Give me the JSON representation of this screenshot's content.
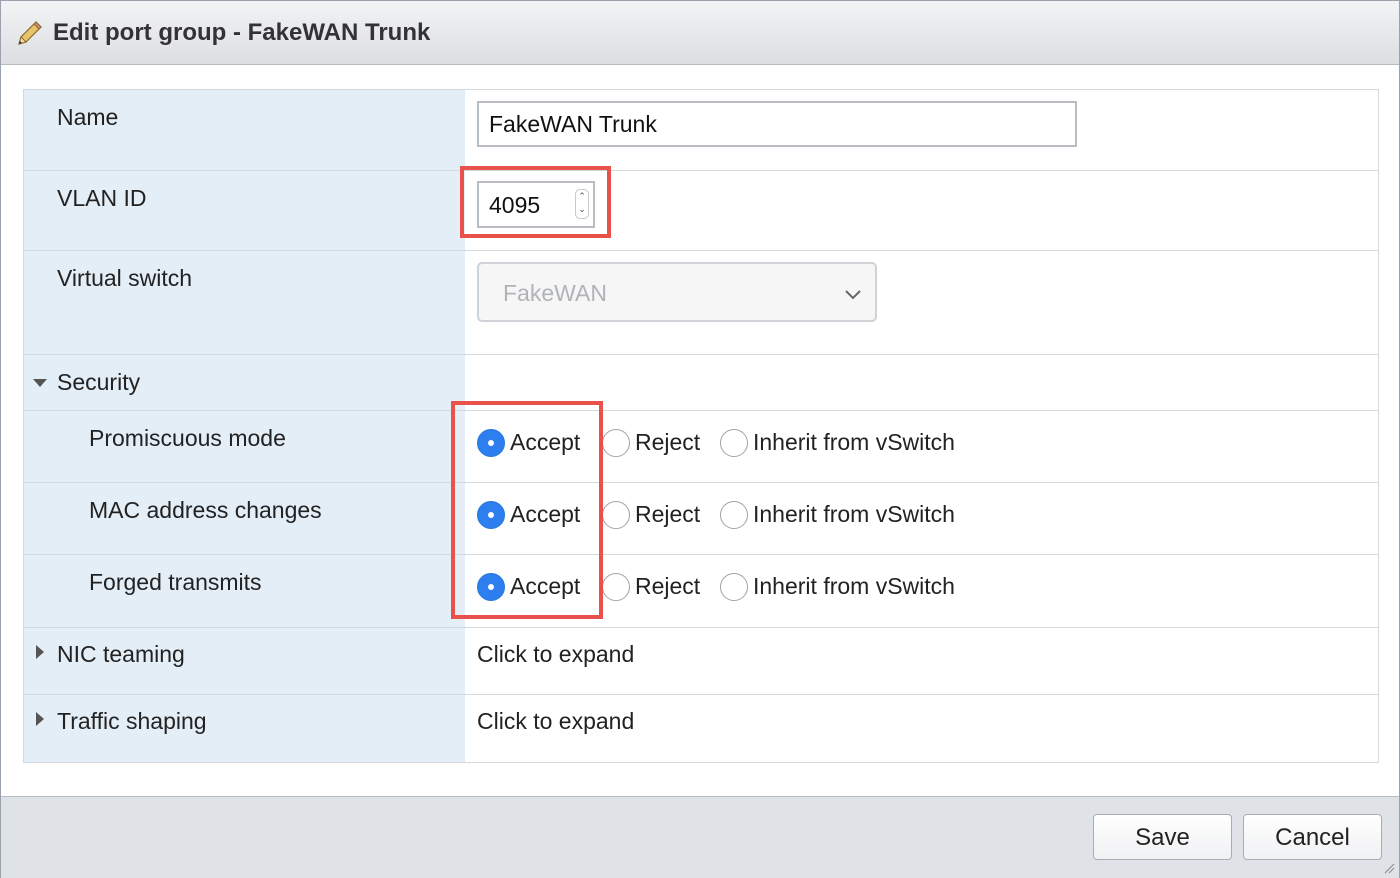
{
  "dialog": {
    "title": "Edit port group - FakeWAN Trunk",
    "title_icon": "pencil-icon"
  },
  "form": {
    "name": {
      "label": "Name",
      "value": "FakeWAN Trunk"
    },
    "vlan_id": {
      "label": "VLAN ID",
      "value": "4095"
    },
    "virtual_switch": {
      "label": "Virtual switch",
      "value": "FakeWAN"
    },
    "security": {
      "label": "Security",
      "expanded": true,
      "settings": [
        {
          "label": "Promiscuous mode",
          "selected": "Accept"
        },
        {
          "label": "MAC address changes",
          "selected": "Accept"
        },
        {
          "label": "Forged transmits",
          "selected": "Accept"
        }
      ],
      "options": {
        "accept": "Accept",
        "reject": "Reject",
        "inherit": "Inherit from vSwitch"
      }
    },
    "nic_teaming": {
      "label": "NIC teaming",
      "value": "Click to expand"
    },
    "traffic_shaping": {
      "label": "Traffic shaping",
      "value": "Click to expand"
    }
  },
  "footer": {
    "save_label": "Save",
    "cancel_label": "Cancel"
  },
  "colors": {
    "highlight": "#e8524a",
    "radio_checked": "#2d7ff0",
    "label_bg": "#e4eef6"
  }
}
